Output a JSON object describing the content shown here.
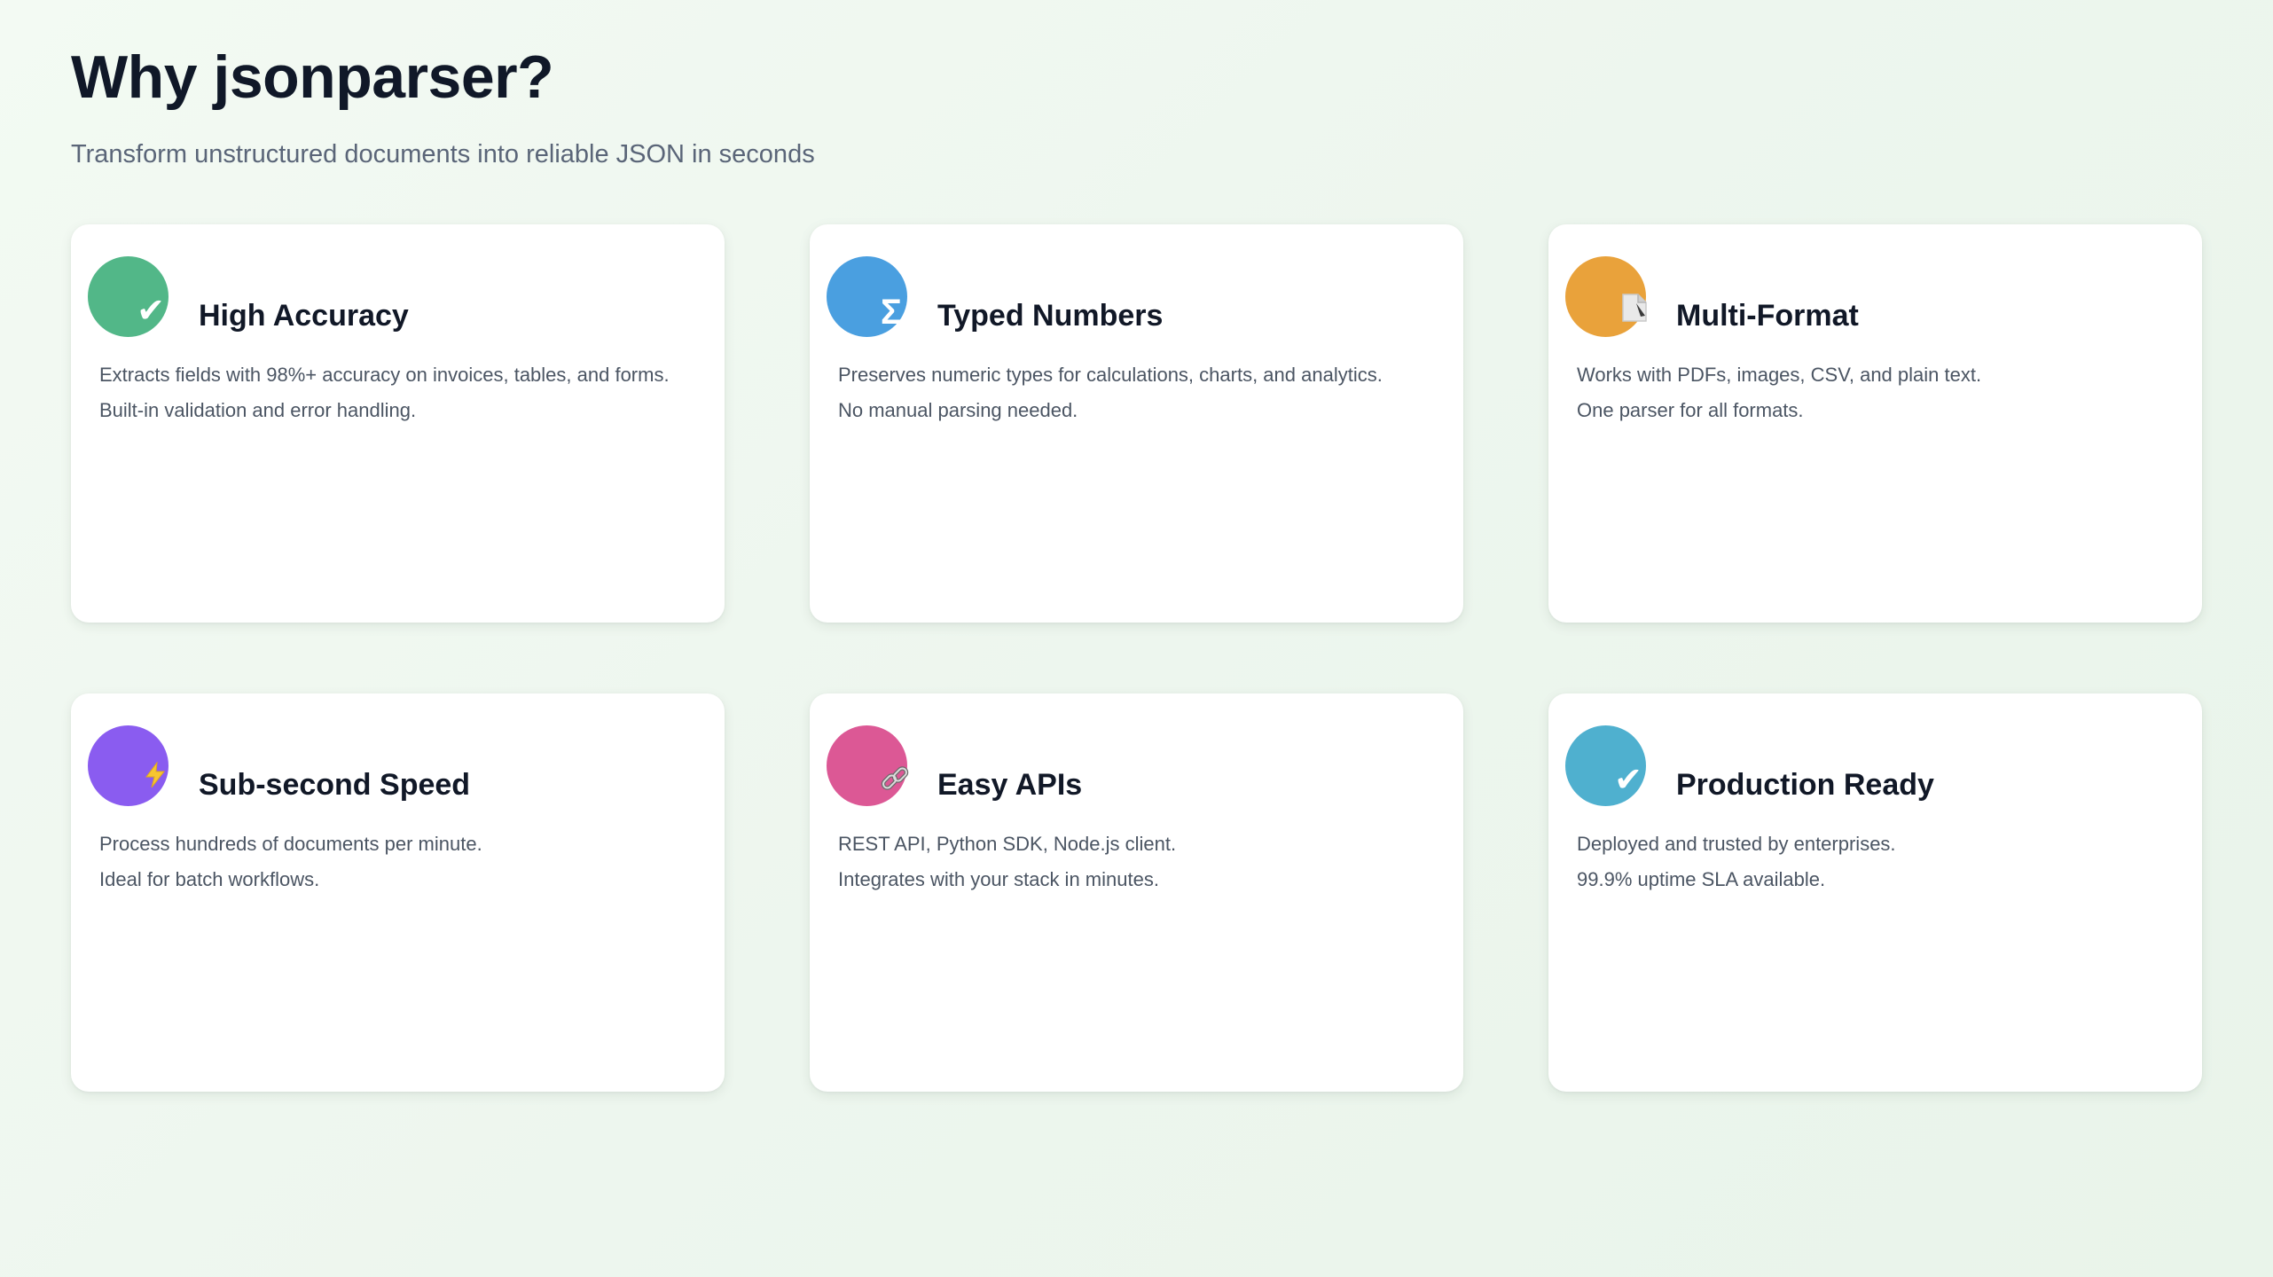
{
  "header": {
    "title": "Why jsonparser?",
    "subtitle": "Transform unstructured documents into reliable JSON in seconds"
  },
  "features": [
    {
      "title": "High Accuracy",
      "lines": [
        "Extracts fields with 98%+ accuracy on invoices, tables, and forms.",
        "Built-in validation and error handling."
      ],
      "icon": "checkmark-icon",
      "color": "#52b788"
    },
    {
      "title": "Typed Numbers",
      "lines": [
        "Preserves numeric types for calculations, charts, and analytics.",
        "No manual parsing needed."
      ],
      "icon": "sigma-icon",
      "color": "#4a9fe0"
    },
    {
      "title": "Multi-Format",
      "lines": [
        "Works with PDFs, images, CSV, and plain text.",
        "One parser for all formats."
      ],
      "icon": "document-icon",
      "color": "#e9a23b"
    },
    {
      "title": "Sub-second Speed",
      "lines": [
        "Process hundreds of documents per minute.",
        "Ideal for batch workflows."
      ],
      "icon": "lightning-icon",
      "color": "#8a5cf0"
    },
    {
      "title": "Easy APIs",
      "lines": [
        "REST API, Python SDK, Node.js client.",
        "Integrates with your stack in minutes."
      ],
      "icon": "link-icon",
      "color": "#dc5895"
    },
    {
      "title": "Production Ready",
      "lines": [
        "Deployed and trusted by enterprises.",
        "99.9% uptime SLA available."
      ],
      "icon": "checkmark-icon",
      "color": "#4fb0cf"
    }
  ]
}
